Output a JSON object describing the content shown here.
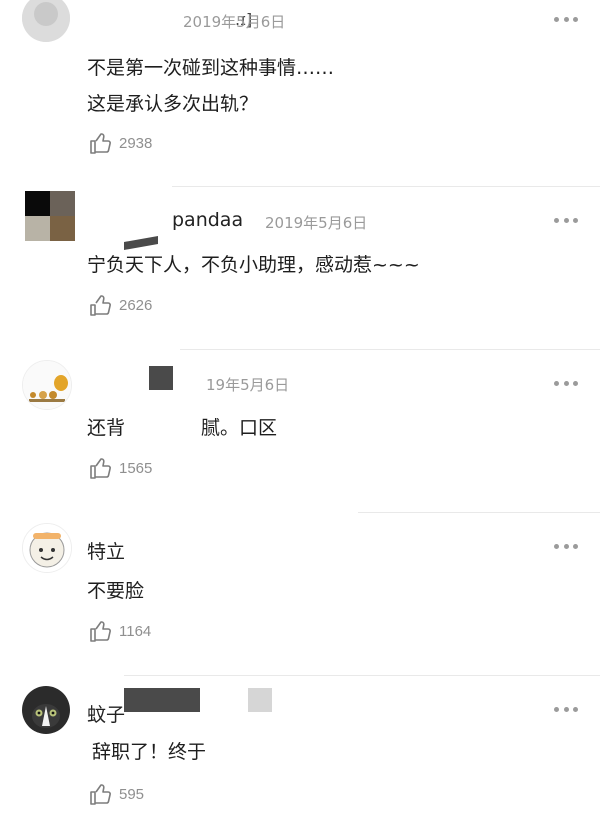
{
  "comments": [
    {
      "username": "",
      "date": "2019年5月6日",
      "lines": [
        "不是第一次碰到这种事情……",
        "这是承认多次出轨？"
      ],
      "likes": "2938",
      "avatar_icon": "avatar-partial-gray"
    },
    {
      "username": "pandaa",
      "date": "2019年5月6日",
      "lines": [
        "宁负天下人，不负小助理，感动惹~~~"
      ],
      "likes": "2626",
      "avatar_icon": "avatar-color-blocks"
    },
    {
      "username": "",
      "date": "19年5月6日",
      "lines": [
        "还背",
        "腻。口区"
      ],
      "likes": "1565",
      "avatar_icon": "avatar-cartoon-figures"
    },
    {
      "username": "特立",
      "date": "",
      "lines": [
        "不要脸"
      ],
      "likes": "1164",
      "avatar_icon": "avatar-cartoon-character"
    },
    {
      "username": "蚊子",
      "date": "",
      "lines": [
        "辞职了！终于"
      ],
      "likes": "595",
      "avatar_icon": "avatar-cat-photo"
    }
  ],
  "icons": {
    "more": "more-options-icon",
    "like": "thumbs-up-icon"
  },
  "colors": {
    "text": "#1e1e1e",
    "meta": "#9a9a9a",
    "divider": "#e9e9e9"
  }
}
